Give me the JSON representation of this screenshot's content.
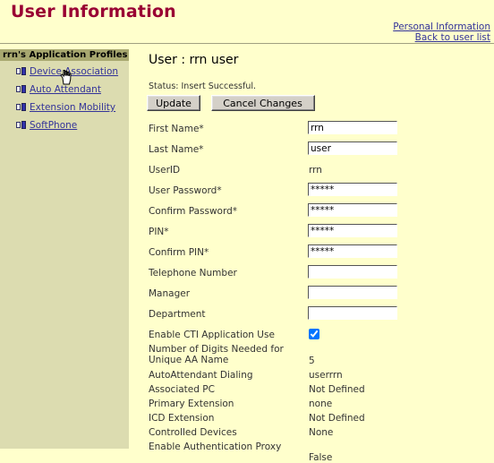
{
  "header": {
    "title": "User Information",
    "links": [
      {
        "label": "Personal Information",
        "name": "personal-information-link"
      },
      {
        "label": "Back to user list",
        "name": "back-to-user-list-link"
      }
    ]
  },
  "sidebar": {
    "header": "rrn's Application Profiles",
    "items": [
      {
        "label": "Device Association"
      },
      {
        "label": "Auto Attendant"
      },
      {
        "label": "Extension Mobility"
      },
      {
        "label": "SoftPhone"
      }
    ]
  },
  "main": {
    "title": "User : rrn user",
    "status": "Status: Insert Successful.",
    "buttons": {
      "update": "Update",
      "cancel": "Cancel Changes"
    },
    "fields": [
      {
        "label": "First Name*",
        "value": "rrn",
        "type": "text"
      },
      {
        "label": "Last Name*",
        "value": "user",
        "type": "text"
      },
      {
        "label": "UserID",
        "value": "rrn",
        "type": "static"
      },
      {
        "label": "User Password*",
        "value": "*****",
        "type": "text"
      },
      {
        "label": "Confirm Password*",
        "value": "*****",
        "type": "text"
      },
      {
        "label": "PIN*",
        "value": "*****",
        "type": "text"
      },
      {
        "label": "Confirm PIN*",
        "value": "*****",
        "type": "text"
      },
      {
        "label": "Telephone Number",
        "value": "",
        "type": "text"
      },
      {
        "label": "Manager",
        "value": "",
        "type": "text"
      },
      {
        "label": "Department",
        "value": "",
        "type": "text"
      },
      {
        "label": "Enable CTI Application Use",
        "value": "checked",
        "type": "checkbox"
      }
    ],
    "readonly": [
      {
        "label": "Number of Digits Needed for\nUnique AA Name",
        "value": "5"
      },
      {
        "label": "AutoAttendant Dialing",
        "value": "userrrn"
      },
      {
        "label": "Associated PC",
        "value": "Not Defined"
      },
      {
        "label": "Primary Extension",
        "value": "none"
      },
      {
        "label": "ICD Extension",
        "value": "Not Defined"
      },
      {
        "label": "Controlled Devices",
        "value": "None"
      },
      {
        "label": "Enable Authentication Proxy",
        "value": "False"
      }
    ]
  },
  "colors": {
    "page_background": "#ffffcc",
    "title": "#990033",
    "link": "#333399",
    "sidebar_background": "#dcdcb0",
    "sidebar_header_background": "#a8a870",
    "button_face": "#d4d0c8"
  }
}
